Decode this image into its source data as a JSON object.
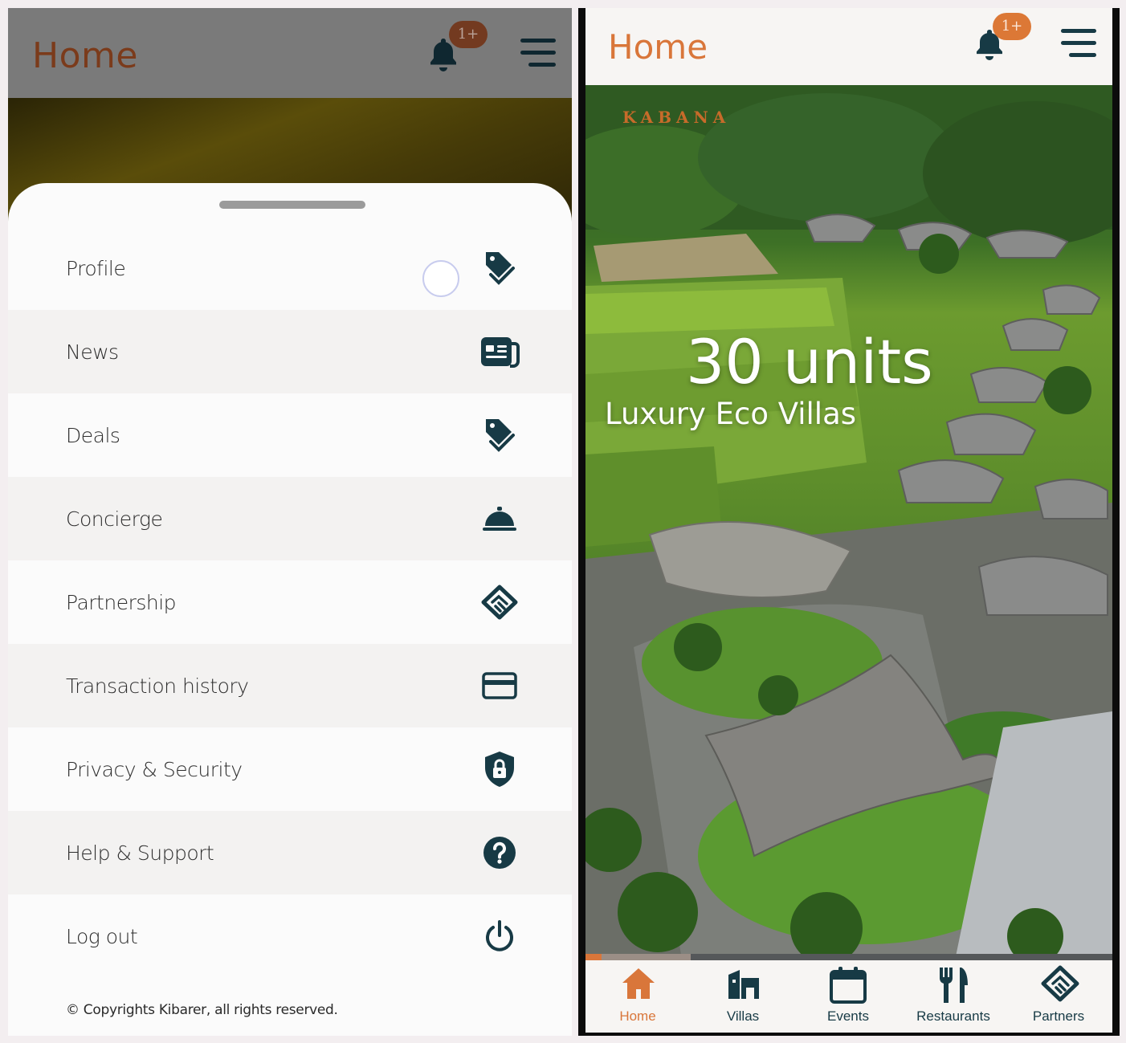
{
  "left": {
    "header": {
      "title": "Home",
      "badge": "1+"
    },
    "menu": [
      {
        "label": "Profile",
        "icon": "tag-icon"
      },
      {
        "label": "News",
        "icon": "newspaper-icon"
      },
      {
        "label": "Deals",
        "icon": "tag-icon"
      },
      {
        "label": "Concierge",
        "icon": "service-bell-icon"
      },
      {
        "label": "Partnership",
        "icon": "handshake-icon"
      },
      {
        "label": "Transaction history",
        "icon": "credit-card-icon"
      },
      {
        "label": "Privacy & Security",
        "icon": "shield-lock-icon"
      },
      {
        "label": "Help & Support",
        "icon": "question-circle-icon"
      },
      {
        "label": "Log out",
        "icon": "power-icon"
      }
    ],
    "copyright": "© Copyrights Kibarer, all rights reserved."
  },
  "right": {
    "header": {
      "title": "Home",
      "badge": "1+"
    },
    "hero": {
      "brand": "KABANA",
      "headline": "30 units",
      "subline": "Luxury Eco Villas",
      "progress": 0.03,
      "buffered": 0.2
    },
    "tabs": [
      {
        "label": "Home",
        "icon": "home-icon",
        "active": true
      },
      {
        "label": "Villas",
        "icon": "building-icon",
        "active": false
      },
      {
        "label": "Events",
        "icon": "calendar-icon",
        "active": false
      },
      {
        "label": "Restaurants",
        "icon": "fork-knife-icon",
        "active": false
      },
      {
        "label": "Partners",
        "icon": "handshake-icon",
        "active": false
      }
    ]
  },
  "colors": {
    "accent": "#d9763a",
    "icon_dark": "#173a45",
    "dimmed_header": "#7a7a7a"
  }
}
